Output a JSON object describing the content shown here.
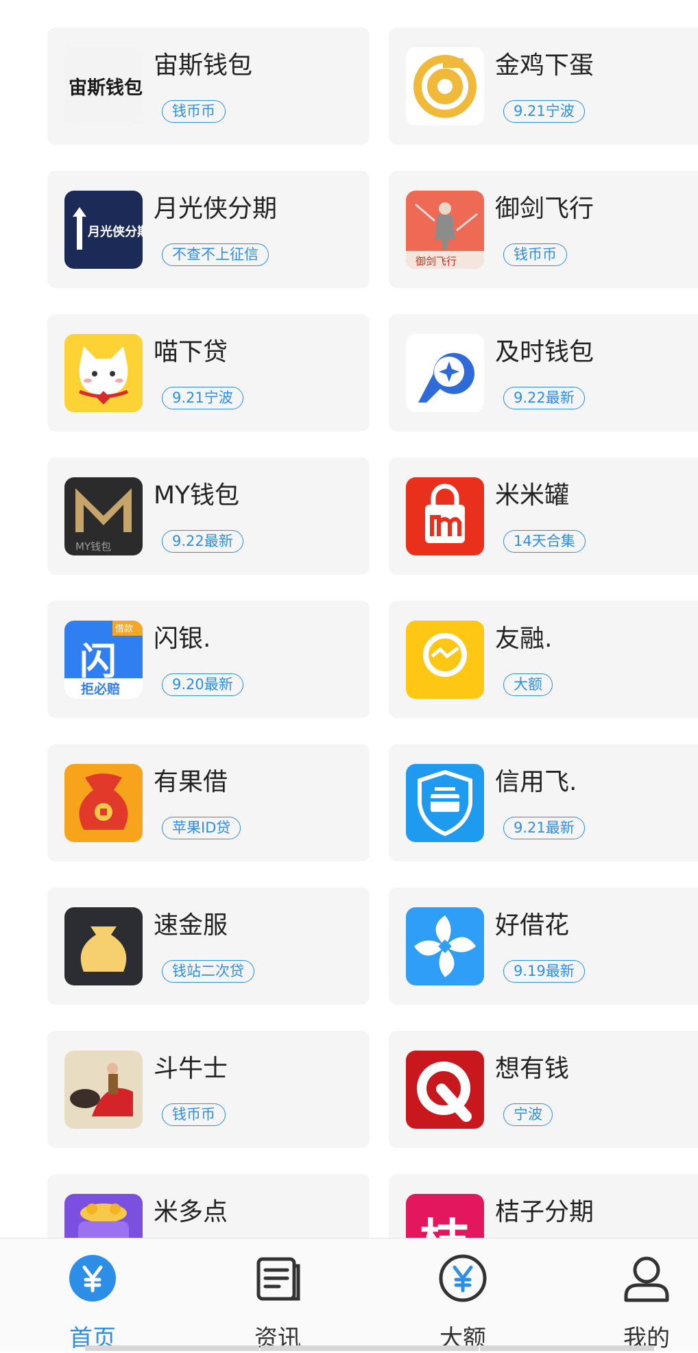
{
  "apps": [
    {
      "name": "宙斯钱包",
      "tag": "钱币币",
      "icon": "zeus-wallet-icon",
      "icon_text": "宙斯钱包"
    },
    {
      "name": "金鸡下蛋",
      "tag": "9.21宁波",
      "icon": "golden-egg-icon"
    },
    {
      "name": "月光侠分期",
      "tag": "不查不上征信",
      "icon": "moonlight-hero-icon",
      "icon_text": "月光侠分期"
    },
    {
      "name": "御剑飞行",
      "tag": "钱币币",
      "icon": "sword-flight-icon",
      "icon_text": "御剑飞行"
    },
    {
      "name": "喵下贷",
      "tag": "9.21宁波",
      "icon": "cat-icon"
    },
    {
      "name": "及时钱包",
      "tag": "9.22最新",
      "icon": "star-swirl-icon"
    },
    {
      "name": "MY钱包",
      "tag": "9.22最新",
      "icon": "my-wallet-icon",
      "icon_text": "MY钱包"
    },
    {
      "name": "米米罐",
      "tag": "14天合集",
      "icon": "shopping-bag-icon"
    },
    {
      "name": "闪银.",
      "tag": "9.20最新",
      "icon": "flash-silver-icon",
      "icon_text": "闪",
      "icon_badge": "借款",
      "icon_sub": "拒必赔"
    },
    {
      "name": "友融.",
      "tag": "大额",
      "icon": "handshake-coin-icon"
    },
    {
      "name": "有果借",
      "tag": "苹果ID贷",
      "icon": "money-bag-icon"
    },
    {
      "name": "信用飞.",
      "tag": "9.21最新",
      "icon": "shield-card-icon"
    },
    {
      "name": "速金服",
      "tag": "钱站二次贷",
      "icon": "gold-pouch-icon"
    },
    {
      "name": "好借花",
      "tag": "9.19最新",
      "icon": "pinwheel-icon"
    },
    {
      "name": "斗牛士",
      "tag": "钱币币",
      "icon": "matador-icon"
    },
    {
      "name": "想有钱",
      "tag": "宁波",
      "icon": "q-logo-icon"
    },
    {
      "name": "米多点",
      "tag": "",
      "icon": "coin-pot-icon"
    },
    {
      "name": "桔子分期",
      "tag": "",
      "icon": "orange-installment-icon",
      "icon_text": "桔"
    }
  ],
  "tabs": [
    {
      "label": "首页",
      "icon": "yen-circle-icon",
      "active": true
    },
    {
      "label": "资讯",
      "icon": "news-icon",
      "active": false
    },
    {
      "label": "大额",
      "icon": "yen-outline-icon",
      "active": false
    },
    {
      "label": "我的",
      "icon": "user-icon",
      "active": false
    }
  ],
  "colors": {
    "accent": "#2d8ee8",
    "card": "#f5f5f5",
    "text": "#222222"
  }
}
